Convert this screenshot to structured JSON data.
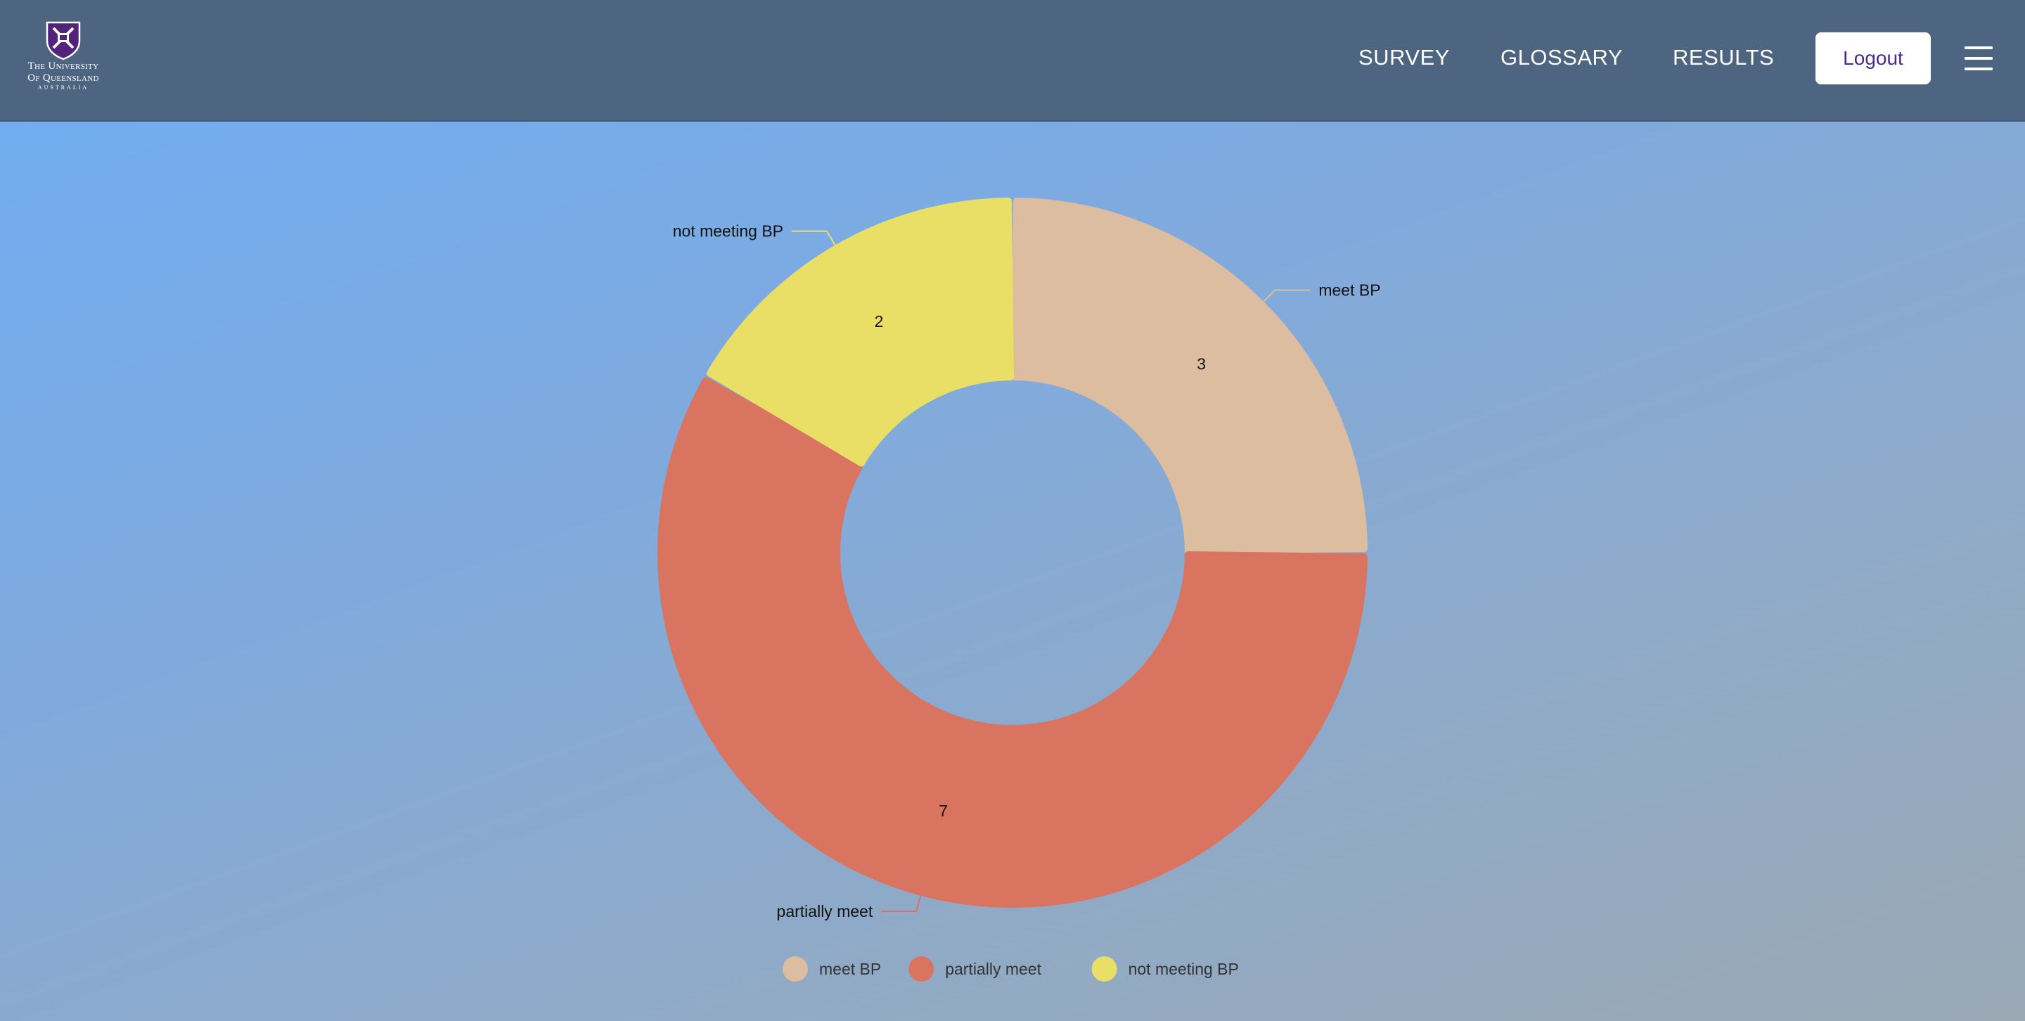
{
  "header": {
    "logo": {
      "line1": "The University",
      "line2": "Of Queensland",
      "line3": "AUSTRALIA"
    },
    "nav": [
      {
        "label": "SURVEY"
      },
      {
        "label": "GLOSSARY"
      },
      {
        "label": "RESULTS"
      }
    ],
    "logout_label": "Logout",
    "menu_icon": "hamburger-icon"
  },
  "colors": {
    "header_bg": "#4e6582",
    "meet_bp": "#dcbd9f",
    "partially_meet": "#d97461",
    "not_meeting_bp": "#e9df66"
  },
  "chart_data": {
    "type": "pie",
    "variant": "donut",
    "categories": [
      "meet BP",
      "partially meet",
      "not meeting BP"
    ],
    "values": [
      3,
      7,
      2
    ],
    "colors": [
      "#dcbd9f",
      "#d97461",
      "#e9df66"
    ],
    "legend": {
      "position": "bottom",
      "entries": [
        "meet BP",
        "partially meet",
        "not meeting BP"
      ]
    },
    "data_labels": [
      "3",
      "7",
      "2"
    ]
  }
}
